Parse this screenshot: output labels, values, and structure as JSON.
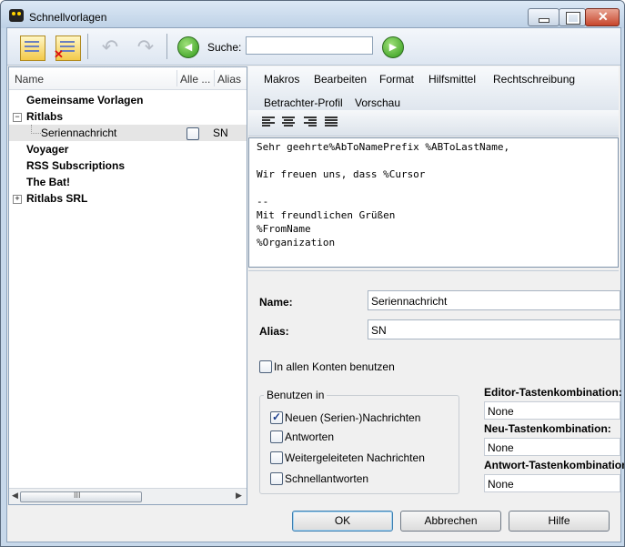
{
  "window": {
    "title": "Schnellvorlagen"
  },
  "toolbar": {
    "search_label": "Suche:",
    "search_value": ""
  },
  "tree": {
    "columns": [
      "Name",
      "Alle ...",
      "Alias"
    ],
    "items": [
      {
        "label": "Gemeinsame Vorlagen"
      },
      {
        "label": "Ritlabs",
        "expander": "−"
      },
      {
        "label": "Seriennachricht",
        "alias": "SN"
      },
      {
        "label": "Voyager"
      },
      {
        "label": "RSS Subscriptions"
      },
      {
        "label": "The Bat!"
      },
      {
        "label": "Ritlabs SRL",
        "expander": "+"
      }
    ],
    "scroll_grip": "III"
  },
  "menu": {
    "items": [
      "Makros",
      "Bearbeiten",
      "Format",
      "Hilfsmittel",
      "Rechtschreibung",
      "Betrachter-Profil",
      "Vorschau"
    ]
  },
  "editor": {
    "text": "Sehr geehrte%AbToNamePrefix %ABToLastName,\n\nWir freuen uns, dass %Cursor\n\n--\nMit freundlichen Grüßen\n%FromName\n%Organization"
  },
  "props": {
    "name_label": "Name:",
    "name_value": "Seriennachricht",
    "alias_label": "Alias:",
    "alias_value": "SN",
    "all_accounts_label": "In allen Konten benutzen",
    "use_in_title": "Benutzen in",
    "use_in": [
      {
        "label": "Neuen (Serien-)Nachrichten",
        "checked": true
      },
      {
        "label": "Antworten",
        "checked": false
      },
      {
        "label": "Weitergeleiteten Nachrichten",
        "checked": false
      },
      {
        "label": "Schnellantworten",
        "checked": false
      }
    ],
    "editor_hotkey_label": "Editor-Tastenkombination:",
    "editor_hotkey_value": "None",
    "new_hotkey_label": "Neu-Tastenkombination:",
    "new_hotkey_value": "None",
    "reply_hotkey_label": "Antwort-Tastenkombination:",
    "reply_hotkey_value": "None"
  },
  "buttons": {
    "ok": "OK",
    "cancel": "Abbrechen",
    "help": "Hilfe"
  }
}
